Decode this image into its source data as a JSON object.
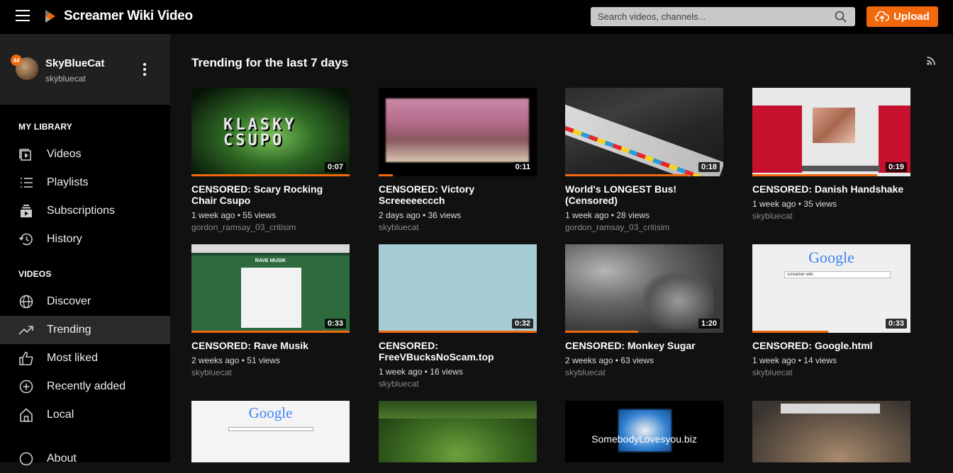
{
  "header": {
    "title": "Screamer Wiki Video",
    "search_placeholder": "Search videos, channels...",
    "upload_label": "Upload"
  },
  "user": {
    "name": "SkyBlueCat",
    "handle": "skybluecat",
    "notifications": "44"
  },
  "sidebar": {
    "library_title": "MY LIBRARY",
    "library_items": [
      {
        "label": "Videos",
        "icon": "video-icon"
      },
      {
        "label": "Playlists",
        "icon": "playlist-icon"
      },
      {
        "label": "Subscriptions",
        "icon": "subscriptions-icon"
      },
      {
        "label": "History",
        "icon": "history-icon"
      }
    ],
    "videos_title": "VIDEOS",
    "videos_items": [
      {
        "label": "Discover",
        "icon": "globe-icon"
      },
      {
        "label": "Trending",
        "icon": "trending-icon"
      },
      {
        "label": "Most liked",
        "icon": "thumbs-up-icon"
      },
      {
        "label": "Recently added",
        "icon": "plus-circle-icon"
      },
      {
        "label": "Local",
        "icon": "home-icon"
      }
    ],
    "about_label": "About"
  },
  "main": {
    "title": "Trending for the last 7 days",
    "videos": [
      {
        "title": "CENSORED: Scary Rocking Chair Csupo",
        "duration": "0:07",
        "age": "1 week ago",
        "views": "55 views",
        "channel": "gordon_ramsay_03_critisim",
        "watched": 1.0
      },
      {
        "title": "CENSORED: Victory Screeeeeccch",
        "duration": "0:11",
        "age": "2 days ago",
        "views": "36 views",
        "channel": "skybluecat",
        "watched": 0.09
      },
      {
        "title": "World's LONGEST Bus! (Censored)",
        "duration": "0:18",
        "age": "1 week ago",
        "views": "28 views",
        "channel": "gordon_ramsay_03_critisim",
        "watched": 0.78
      },
      {
        "title": "CENSORED: Danish Handshake",
        "duration": "0:19",
        "age": "1 week ago",
        "views": "35 views",
        "channel": "skybluecat",
        "watched": 0.79
      },
      {
        "title": "CENSORED: Rave Musik",
        "duration": "0:33",
        "age": "2 weeks ago",
        "views": "51 views",
        "channel": "skybluecat",
        "watched": 1.0
      },
      {
        "title": "CENSORED: FreeVBucksNoScam.top",
        "duration": "0:32",
        "age": "1 week ago",
        "views": "16 views",
        "channel": "skybluecat",
        "watched": 1.0
      },
      {
        "title": "CENSORED: Monkey Sugar",
        "duration": "1:20",
        "age": "2 weeks ago",
        "views": "63 views",
        "channel": "skybluecat",
        "watched": 0.46
      },
      {
        "title": "CENSORED: Google.html",
        "duration": "0:33",
        "age": "1 week ago",
        "views": "14 views",
        "channel": "skybluecat",
        "watched": 0.48
      },
      {
        "title": "",
        "duration": "",
        "age": "",
        "views": "",
        "channel": "",
        "watched": 0
      },
      {
        "title": "",
        "duration": "",
        "age": "",
        "views": "",
        "channel": "",
        "watched": 0
      },
      {
        "title": "",
        "duration": "",
        "age": "",
        "views": "",
        "channel": "",
        "watched": 0
      },
      {
        "title": "",
        "duration": "",
        "age": "",
        "views": "",
        "channel": "",
        "watched": 0
      }
    ],
    "thumb_texts": {
      "t1": "KLASKY CSUPO",
      "t5": "RAVE MUSIK",
      "t8": "Google",
      "t8_query": "screamer wiki",
      "t9": "Google",
      "t11": "SomebodyLovesyou.biz"
    }
  },
  "colors": {
    "accent": "#f1680d",
    "background": "#111111",
    "sidebar": "#000000"
  }
}
